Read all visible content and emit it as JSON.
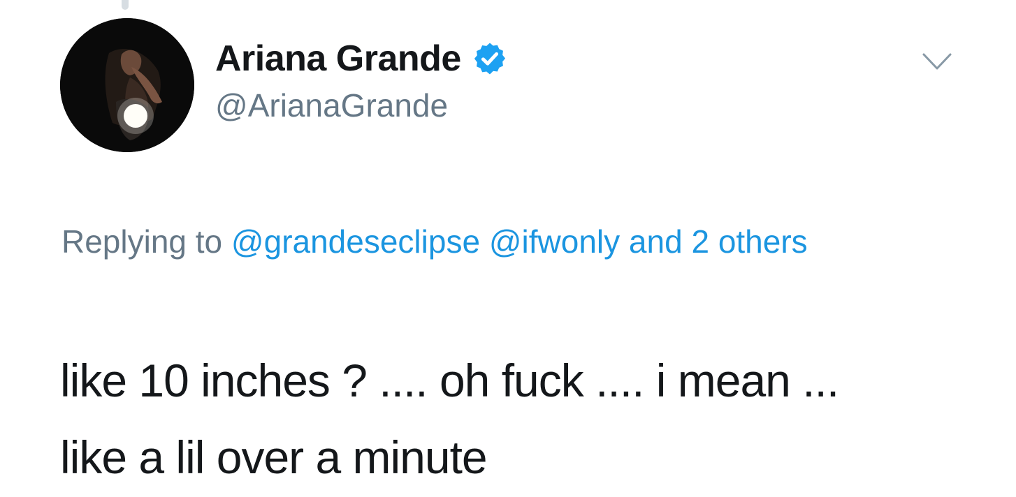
{
  "author": {
    "display_name": "Ariana Grande",
    "handle": "@ArianaGrande",
    "verified": true,
    "verified_icon": "verified-badge-icon",
    "avatar_icon": "profile-photo"
  },
  "menu": {
    "caret_icon": "chevron-down-icon"
  },
  "reply_context": {
    "prefix": "Replying to",
    "mention_1": "@grandeseclipse",
    "mention_2": "@ifwonly",
    "others": "and 2 others"
  },
  "tweet": {
    "lines": [
      "like 10 inches ? .... oh fuck .... i mean ...",
      "like a lil over a minute"
    ]
  },
  "colors": {
    "text": "#14171a",
    "secondary": "#657786",
    "link": "#1b95e0",
    "verified": "#1da1f2",
    "thread_line": "#d7dde2"
  }
}
